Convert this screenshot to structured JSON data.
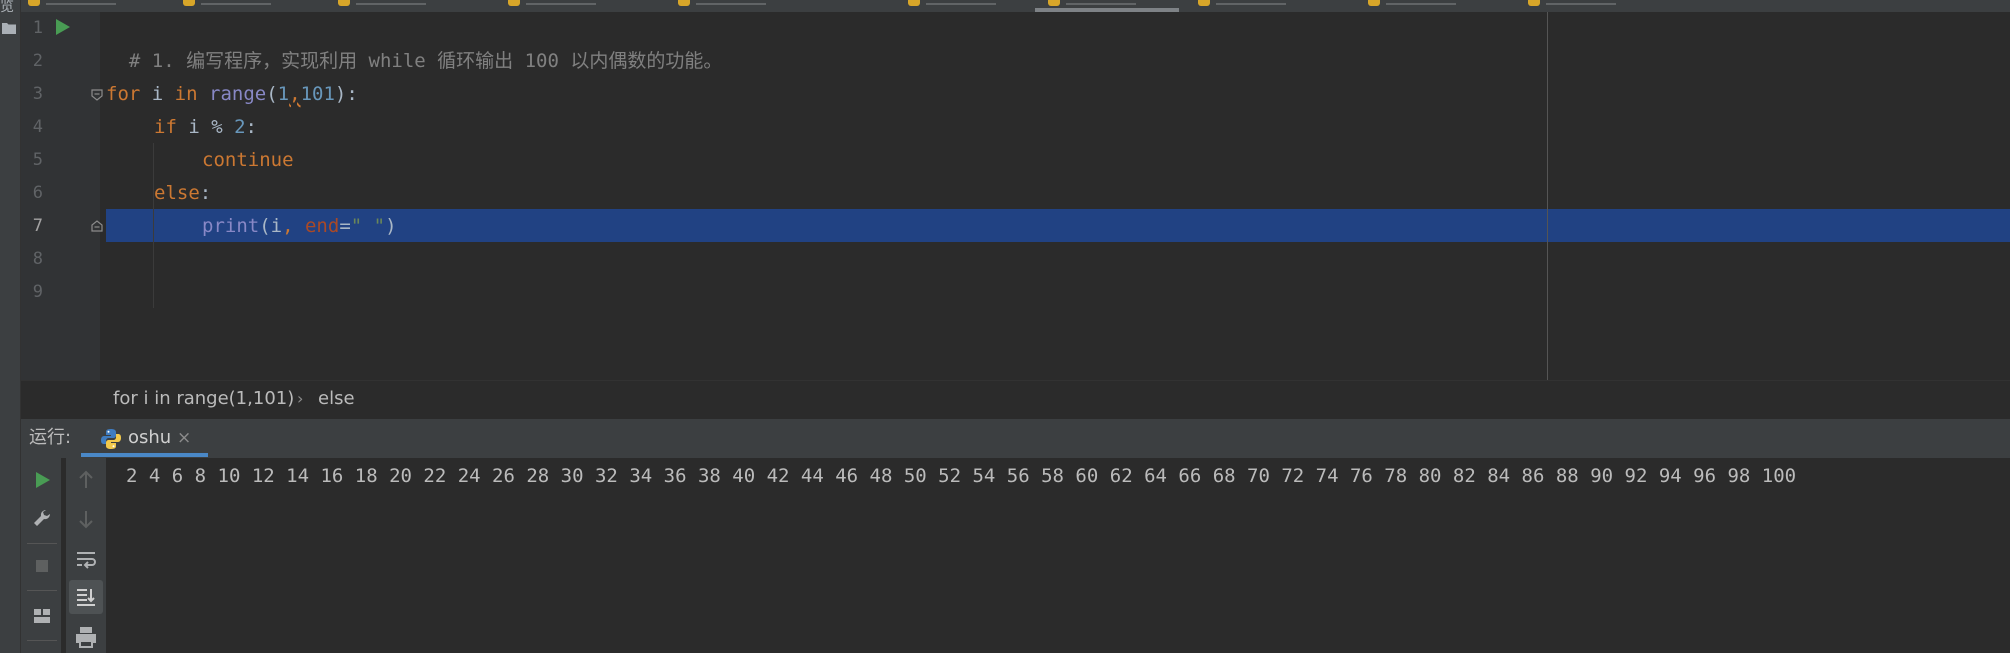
{
  "side_strip": {
    "label": "览"
  },
  "editor": {
    "lines": [
      {
        "no": "1",
        "comment": "# 1. 编写程序，实现利用 while 循环输出 100 以内偶数的功能。"
      },
      {
        "no": "2"
      },
      {
        "no": "3",
        "kw": "for",
        "var": " i ",
        "in": "in",
        "fn": "range",
        "open": "(",
        "n1": "1",
        "comma": ",",
        "n2": "101",
        "close": "):"
      },
      {
        "no": "4",
        "kw": "if",
        "mid": " i % ",
        "n": "2",
        "end": ":"
      },
      {
        "no": "5",
        "kw": "continue"
      },
      {
        "no": "6",
        "kw": "else",
        "end": ":"
      },
      {
        "no": "7",
        "fn": "print",
        "a": "(i",
        "comma": ", ",
        "kwarg": "end",
        "eq": "=",
        "str": "\" \"",
        "close": ")"
      },
      {
        "no": "8"
      },
      {
        "no": "9"
      }
    ]
  },
  "breadcrumb": {
    "item1": "for i in range(1,101)",
    "sep": "›",
    "item2": "else"
  },
  "run_panel": {
    "label": "运行:",
    "tab_label": "oshu",
    "close_glyph": "×",
    "output": "2 4 6 8 10 12 14 16 18 20 22 24 26 28 30 32 34 36 38 40 42 44 46 48 50 52 54 56 58 60 62 64 66 68 70 72 74 76 78 80 82 84 86 88 90 92 94 96 98 100"
  },
  "colors": {
    "editor_bg": "#2b2b2b",
    "gutter_bg": "#313335",
    "current_line": "#214283",
    "keyword": "#cc7832",
    "builtin": "#8888c6",
    "number": "#6897bb",
    "comment": "#808080",
    "string": "#6a8759",
    "run_green": "#499c54"
  }
}
